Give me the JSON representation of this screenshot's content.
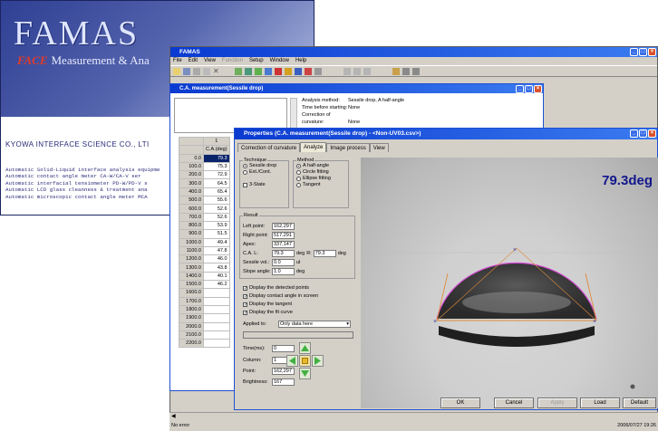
{
  "splash": {
    "logo": "FAMAS",
    "face": "FACE",
    "subtitle": "Measurement & Ana",
    "company": "KYOWA INTERFACE SCIENCE CO., LTI",
    "lines": [
      "Automatic Solid-Liquid interface analysis equipme",
      "Automatic contact angle meter CA-W/CA-V ser",
      "Automatic interfacial tensiometer PD-W/PD-V s",
      "Automatic LCD glass cleanness & treatment ana",
      "Automatic microscopic contact angle meter MCA"
    ]
  },
  "app": {
    "title": "FAMAS",
    "menus": [
      {
        "label": "File",
        "disabled": false
      },
      {
        "label": "Edit",
        "disabled": false
      },
      {
        "label": "View",
        "disabled": false
      },
      {
        "label": "Function",
        "disabled": true
      },
      {
        "label": "Setup",
        "disabled": false
      },
      {
        "label": "Window",
        "disabled": false
      },
      {
        "label": "Help",
        "disabled": false
      }
    ]
  },
  "child": {
    "title": "C.A. measurement(Sessile drop)",
    "info": [
      {
        "k": "Analysis method:",
        "v": "Sessile drop, A half-angle"
      },
      {
        "k": "Time before starting:",
        "v": "None"
      },
      {
        "k": "Correction of curvature:",
        "v": "None"
      }
    ],
    "col_header_top": "1",
    "col_header": "C.A.(deg)",
    "rows": [
      {
        "t": "0.0",
        "v": "79.3"
      },
      {
        "t": "100.0",
        "v": "75.3"
      },
      {
        "t": "200.0",
        "v": "72.9"
      },
      {
        "t": "300.0",
        "v": "64.5"
      },
      {
        "t": "400.0",
        "v": "65.4"
      },
      {
        "t": "500.0",
        "v": "55.6"
      },
      {
        "t": "600.0",
        "v": "52.6"
      },
      {
        "t": "700.0",
        "v": "52.6"
      },
      {
        "t": "800.0",
        "v": "53.9"
      },
      {
        "t": "900.0",
        "v": "51.5"
      },
      {
        "t": "1000.0",
        "v": "49.4"
      },
      {
        "t": "1100.0",
        "v": "47.8"
      },
      {
        "t": "1200.0",
        "v": "46.0"
      },
      {
        "t": "1300.0",
        "v": "43.8"
      },
      {
        "t": "1400.0",
        "v": "40.1"
      },
      {
        "t": "1500.0",
        "v": "46.2"
      },
      {
        "t": "1600.0",
        "v": ""
      },
      {
        "t": "1700.0",
        "v": ""
      },
      {
        "t": "1800.0",
        "v": ""
      },
      {
        "t": "1900.0",
        "v": ""
      },
      {
        "t": "2000.0",
        "v": ""
      },
      {
        "t": "2100.0",
        "v": ""
      },
      {
        "t": "2200.0",
        "v": ""
      }
    ]
  },
  "props": {
    "title": "Properties (C.A. measurement(Sessile drop) - <Non-UV03.csv>)",
    "tabs": [
      "Correction of curvature",
      "Analyze",
      "Image process",
      "View"
    ],
    "technique": {
      "label": "Technique",
      "opts": [
        "Sessile drop",
        "Ext./Cont."
      ],
      "three_state": "3-State"
    },
    "method": {
      "label": "Method",
      "opts": [
        "A half-angle",
        "Circle fitting",
        "Ellipse fitting",
        "Tangent"
      ]
    },
    "result": {
      "label": "Result",
      "left_point": {
        "k": "Left point:",
        "v": "162,297"
      },
      "right_point": {
        "k": "Right point:",
        "v": "517,291"
      },
      "apex": {
        "k": "Apex:",
        "v": "337,147"
      },
      "ca": {
        "kl": "C.A. L:",
        "vl": "79.3",
        "unit": "deg",
        "kr": "R:",
        "vr": "79.3"
      },
      "sessile": {
        "k": "Sessile vol.:",
        "v": "0.0",
        "unit": "ul"
      },
      "slope": {
        "k": "Slope angle:",
        "v": "1.0",
        "unit": "deg"
      }
    },
    "checks": [
      "Display the detected points",
      "Display contact angle in screen",
      "Display the tangent",
      "Display the fit curve"
    ],
    "applied_label": "Applied to:",
    "applied_value": "Only data here",
    "time": {
      "k": "Time(ms):",
      "v": "0"
    },
    "column": {
      "k": "Column:",
      "v": "1"
    },
    "point": {
      "k": "Point:",
      "v": "162,297"
    },
    "brightness": {
      "k": "Brightness:",
      "v": "167"
    },
    "angle_overlay": "79.3deg",
    "buttons": {
      "ok": "OK",
      "cancel": "Cancel",
      "apply": "Apply",
      "load": "Load",
      "default": "Default"
    }
  },
  "status": {
    "left": "No error",
    "right": "2006/07/27 19:26"
  },
  "colors": {
    "title_blue": "#0a3ad0",
    "accent_blue": "#12178c",
    "drop_pink": "#d64ad6",
    "tangent_orange": "#e08a3c"
  }
}
